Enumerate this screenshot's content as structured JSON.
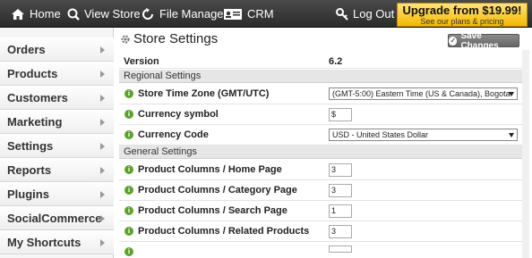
{
  "topbar": {
    "home": "Home",
    "view_store": "View Store",
    "file_manager": "File Manager",
    "crm": "CRM",
    "logout": "Log Out",
    "upgrade_big": "Upgrade from $19.99!",
    "upgrade_small": "See our plans & pricing"
  },
  "sidebar": {
    "items": [
      {
        "label": "Orders"
      },
      {
        "label": "Products"
      },
      {
        "label": "Customers"
      },
      {
        "label": "Marketing"
      },
      {
        "label": "Settings"
      },
      {
        "label": "Reports"
      },
      {
        "label": "Plugins"
      },
      {
        "label": "SocialCommerce"
      },
      {
        "label": "My Shortcuts"
      }
    ]
  },
  "main": {
    "title": "Store Settings",
    "save_label": "Save Changes",
    "version_label": "Version",
    "version_value": "6.2",
    "regional_heading": "Regional Settings",
    "timezone_label": "Store Time Zone (GMT/UTC)",
    "timezone_value": "(GMT-5:00) Eastern Time (US & Canada), Bogota",
    "currency_symbol_label": "Currency symbol",
    "currency_symbol_value": "$",
    "currency_code_label": "Currency Code",
    "currency_code_value": "USD - United States Dollar",
    "general_heading": "General Settings",
    "pc_home_label": "Product Columns / Home Page",
    "pc_home_value": "3",
    "pc_category_label": "Product Columns / Category Page",
    "pc_category_value": "3",
    "pc_search_label": "Product Columns / Search Page",
    "pc_search_value": "1",
    "pc_related_label": "Product Columns / Related Products",
    "pc_related_value": "3"
  }
}
